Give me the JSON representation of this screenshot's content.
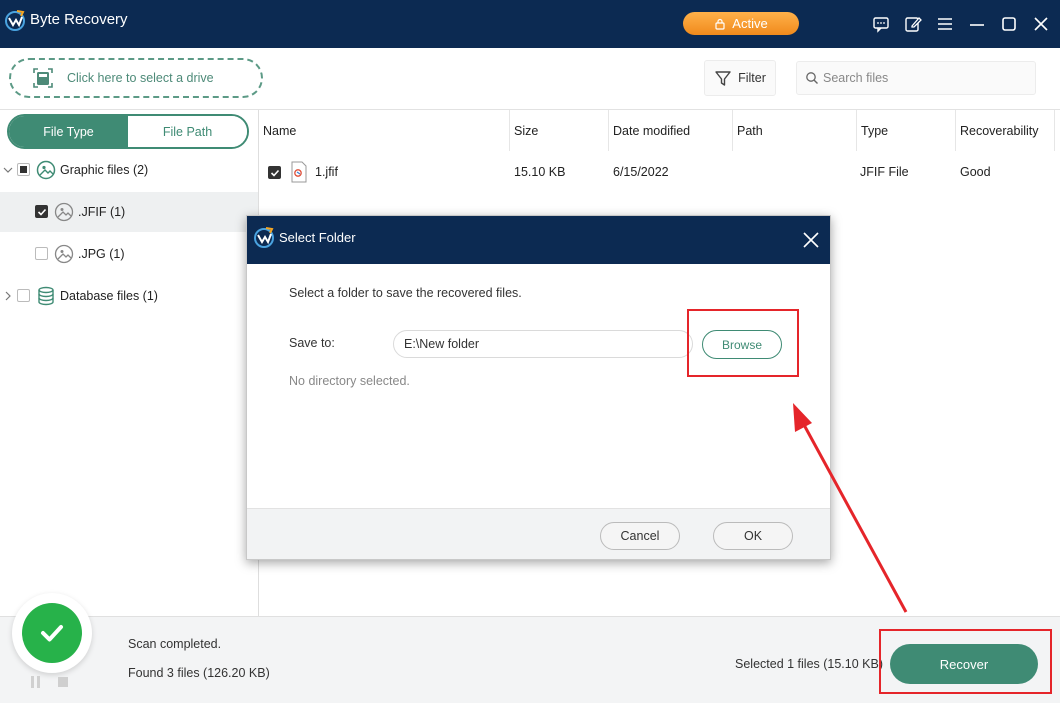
{
  "app": {
    "title": "Byte Recovery",
    "active_label": "Active",
    "colors": {
      "titlebar": "#0c2a52",
      "accent": "#3f8b74",
      "active_orange": "#f39a2b",
      "success_green": "#27b24a",
      "highlight_red": "#e5252a"
    },
    "window_icons": [
      "feedback-icon",
      "edit-icon",
      "menu-icon",
      "minimize-icon",
      "maximize-icon",
      "close-icon"
    ]
  },
  "toolbar": {
    "drive_prompt": "Click here to select a drive",
    "filter_label": "Filter",
    "search_placeholder": "Search files"
  },
  "sidebar": {
    "tabs": [
      "File Type",
      "File Path"
    ],
    "active_tab": "File Type",
    "tree": [
      {
        "label": "Graphic files (2)",
        "level": 0,
        "expanded": true,
        "check": "partial",
        "icon": "image-group-icon"
      },
      {
        "label": ".JFIF (1)",
        "level": 1,
        "check": "checked",
        "selected": true,
        "icon": "image-icon"
      },
      {
        "label": ".JPG (1)",
        "level": 1,
        "check": "unchecked",
        "icon": "image-icon"
      },
      {
        "label": "Database files (1)",
        "level": 0,
        "expanded": false,
        "check": "unchecked",
        "icon": "database-icon"
      }
    ]
  },
  "files": {
    "columns": [
      "Name",
      "Size",
      "Date modified",
      "Path",
      "Type",
      "Recoverability"
    ],
    "rows": [
      {
        "name": "1.jfif",
        "size": "15.10 KB",
        "date": "6/15/2022",
        "path": "",
        "type": "JFIF File",
        "recoverability": "Good",
        "checked": true
      }
    ]
  },
  "status": {
    "scan_status": "Scan completed.",
    "found": "Found 3 files (126.20 KB)",
    "selected": "Selected 1 files (15.10 KB)",
    "recover_label": "Recover"
  },
  "dialog": {
    "title": "Select Folder",
    "instruction": "Select a folder to save the recovered files.",
    "save_to_label": "Save to:",
    "path_value": "E:\\New folder",
    "browse_label": "Browse",
    "hint": "No directory selected.",
    "cancel_label": "Cancel",
    "ok_label": "OK"
  }
}
